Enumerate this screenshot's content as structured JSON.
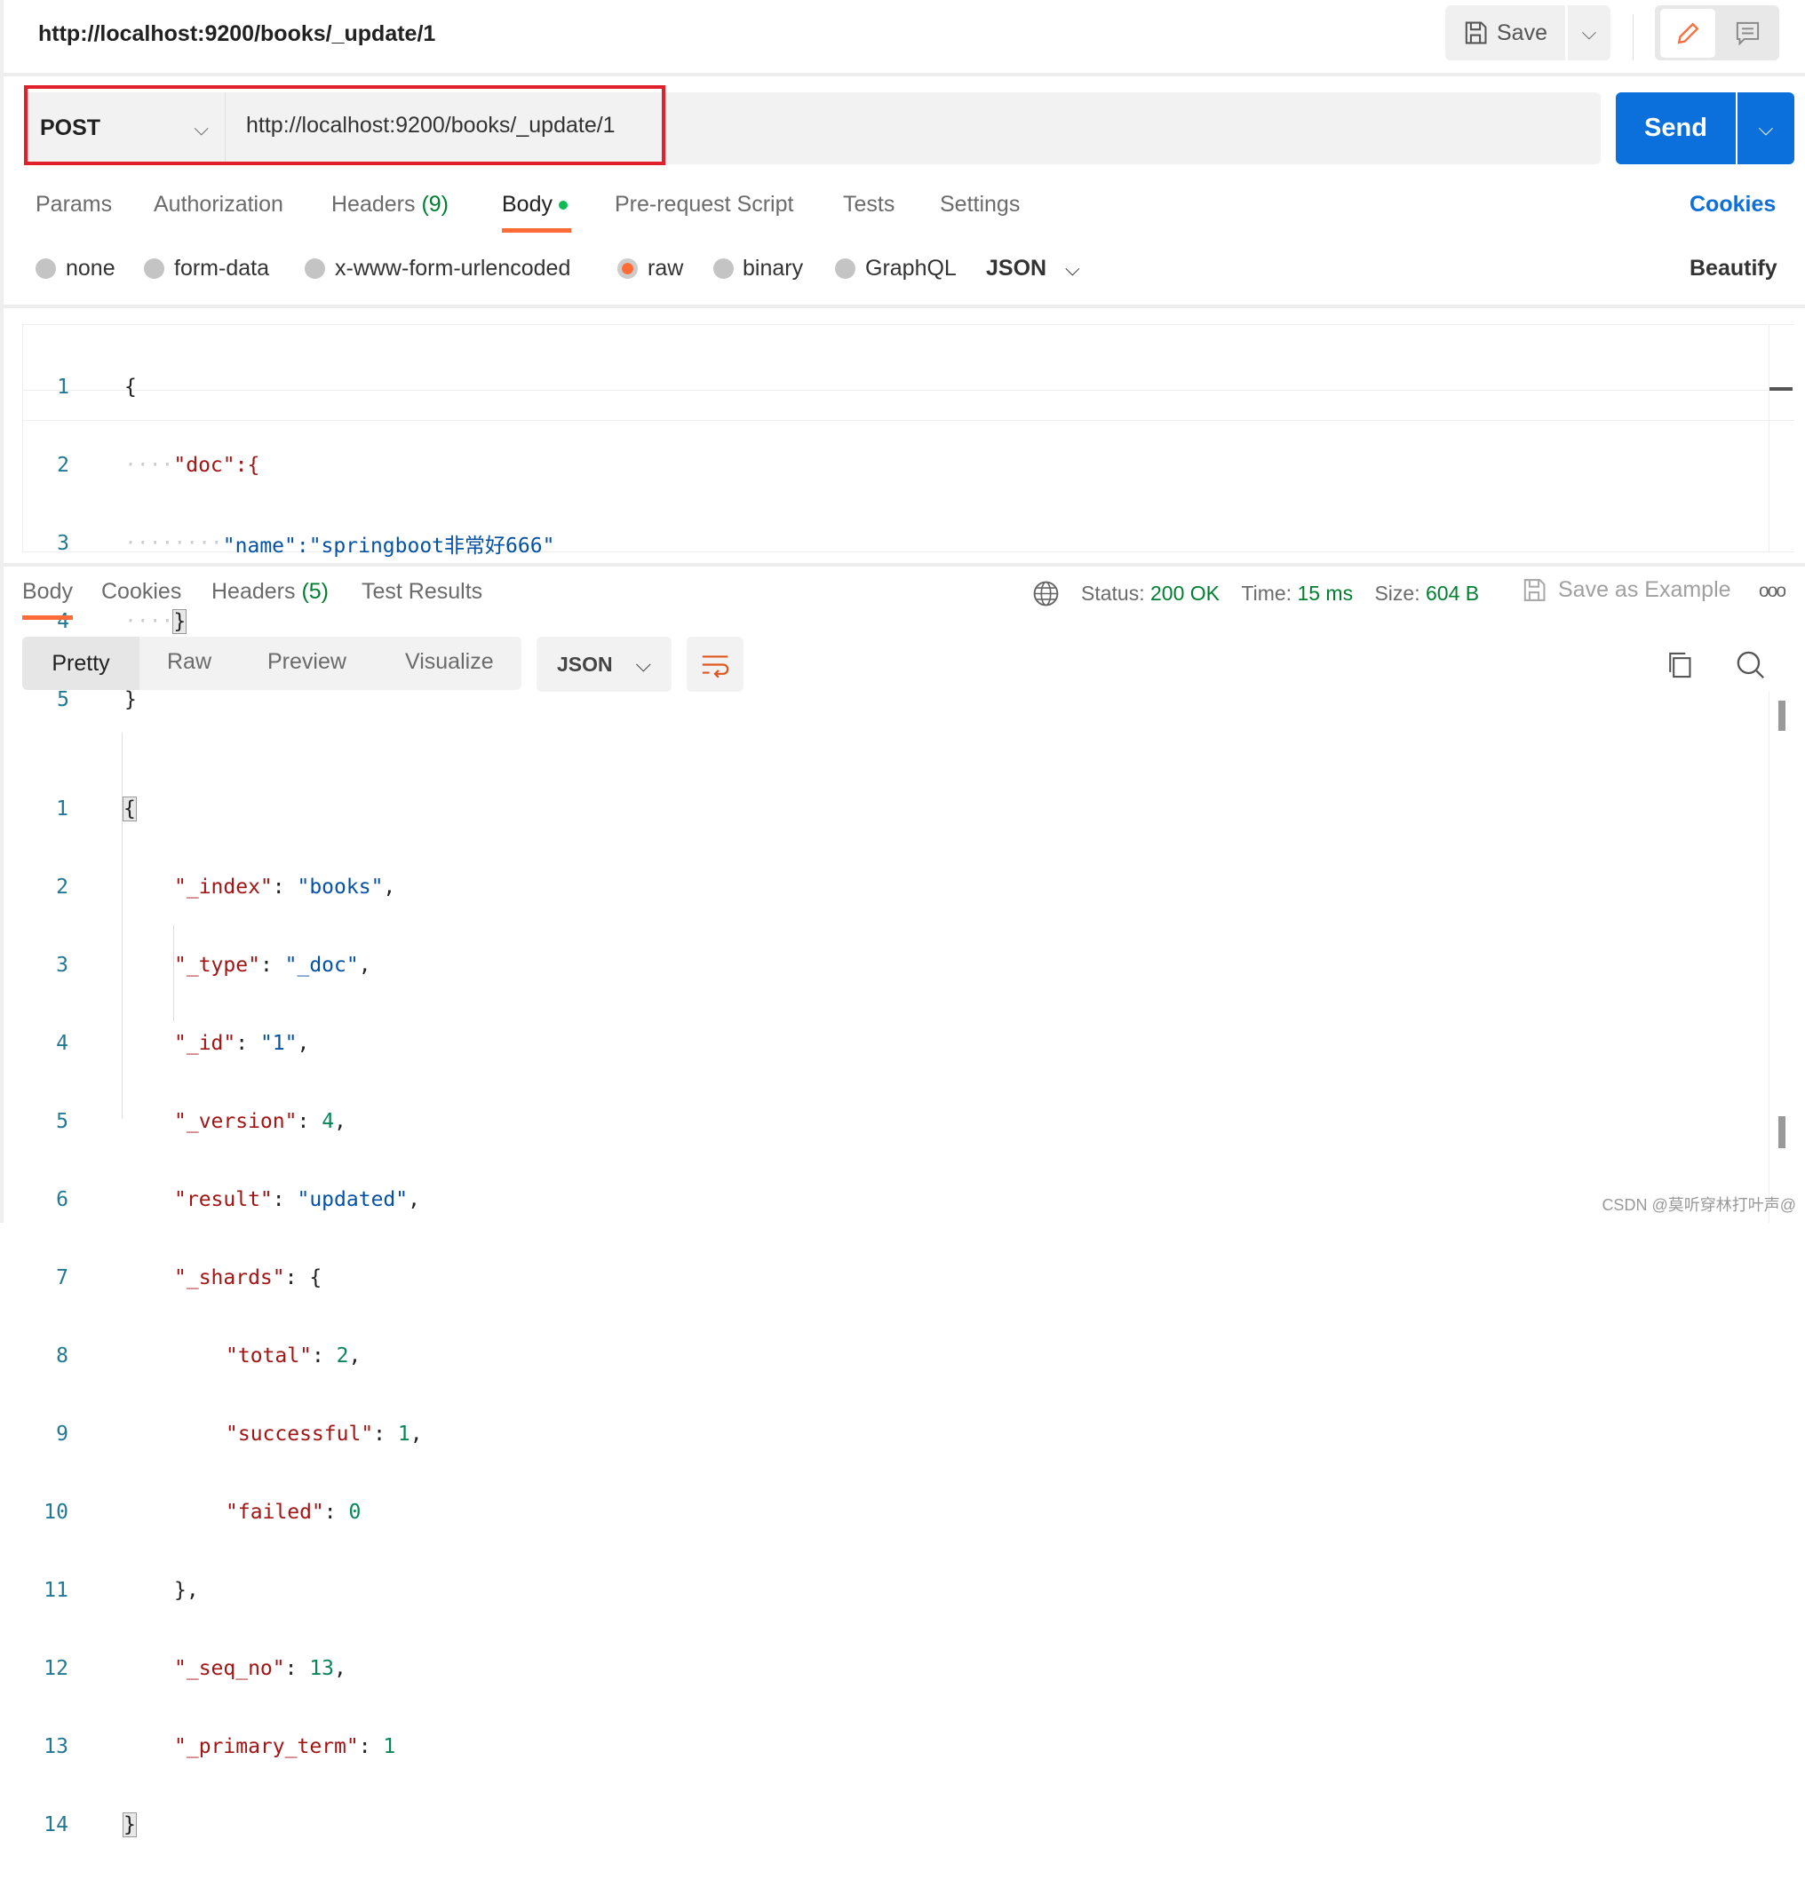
{
  "header": {
    "title": "http://localhost:9200/books/_update/1",
    "save_label": "Save"
  },
  "request": {
    "method": "POST",
    "url": "http://localhost:9200/books/_update/1",
    "send_label": "Send"
  },
  "request_tabs": [
    {
      "label": "Params"
    },
    {
      "label": "Authorization"
    },
    {
      "label": "Headers ",
      "count": "(9)"
    },
    {
      "label": "Body"
    },
    {
      "label": "Pre-request Script"
    },
    {
      "label": "Tests"
    },
    {
      "label": "Settings"
    }
  ],
  "cookies_label": "Cookies",
  "body_types": [
    {
      "label": "none"
    },
    {
      "label": "form-data"
    },
    {
      "label": "x-www-form-urlencoded"
    },
    {
      "label": "raw",
      "selected": true
    },
    {
      "label": "binary"
    },
    {
      "label": "GraphQL"
    }
  ],
  "body_format": "JSON",
  "beautify_label": "Beautify",
  "request_body_lines": [
    "{",
    "\"doc\":{",
    "\"name\":\"springboot非常好666\"",
    "}",
    "}"
  ],
  "response": {
    "tabs": [
      {
        "label": "Body"
      },
      {
        "label": "Cookies"
      },
      {
        "label": "Headers ",
        "count": "(5)"
      },
      {
        "label": "Test Results"
      }
    ],
    "status_label": "Status:",
    "status": "200 OK",
    "time_label": "Time:",
    "time": "15 ms",
    "size_label": "Size:",
    "size": "604 B",
    "save_example_label": "Save as Example",
    "views": [
      "Pretty",
      "Raw",
      "Preview",
      "Visualize"
    ],
    "format": "JSON"
  },
  "watermark": "CSDN @莫听穿林打叶声@",
  "colors": {
    "accent": "#ff6c37",
    "send": "#0b6fdc",
    "status": "#007f31"
  }
}
